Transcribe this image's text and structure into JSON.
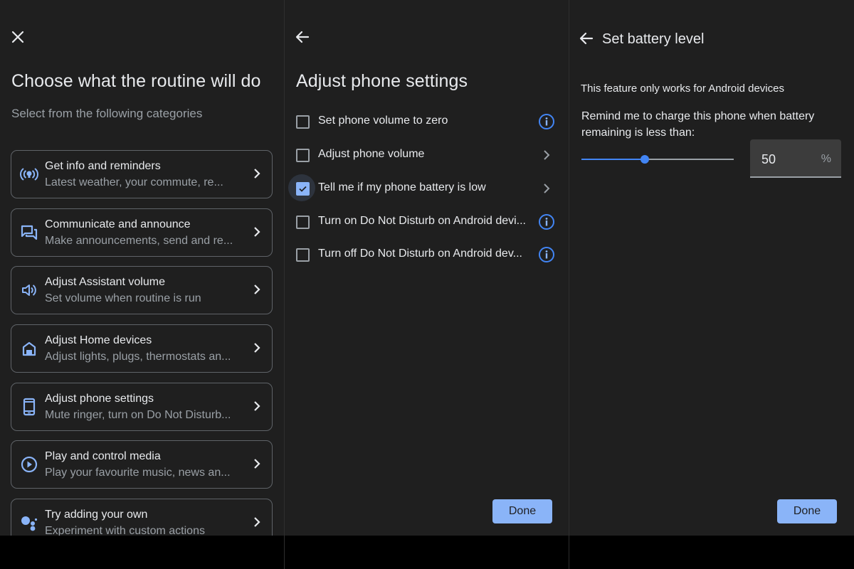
{
  "panel1": {
    "close_icon": "close-icon",
    "title": "Choose what the routine will do",
    "subtitle": "Select from the following categories",
    "categories": [
      {
        "icon": "broadcast-lightbulb-icon",
        "title": "Get info and reminders",
        "desc": "Latest weather, your commute, re..."
      },
      {
        "icon": "chat-bubbles-icon",
        "title": "Communicate and announce",
        "desc": "Make announcements, send and re..."
      },
      {
        "icon": "speaker-volume-icon",
        "title": "Adjust Assistant volume",
        "desc": "Set volume when routine is run"
      },
      {
        "icon": "home-icon",
        "title": "Adjust Home devices",
        "desc": "Adjust lights, plugs, thermostats an..."
      },
      {
        "icon": "phone-icon",
        "title": "Adjust phone settings",
        "desc": "Mute ringer, turn on Do Not Disturb..."
      },
      {
        "icon": "play-circle-icon",
        "title": "Play and control media",
        "desc": "Play your favourite music, news an..."
      },
      {
        "icon": "assistant-dots-icon",
        "title": "Try adding your own",
        "desc": "Experiment with custom actions"
      }
    ]
  },
  "panel2": {
    "back_icon": "back-arrow-icon",
    "title": "Adjust phone settings",
    "options": [
      {
        "label": "Set phone volume to zero",
        "checked": false,
        "tail": "info"
      },
      {
        "label": "Adjust phone volume",
        "checked": false,
        "tail": "chevron"
      },
      {
        "label": "Tell me if my phone battery is low",
        "checked": true,
        "tail": "chevron"
      },
      {
        "label": "Turn on Do Not Disturb on Android devi...",
        "checked": false,
        "tail": "info"
      },
      {
        "label": "Turn off Do Not Disturb on Android dev...",
        "checked": false,
        "tail": "info"
      }
    ],
    "done_label": "Done"
  },
  "panel3": {
    "back_icon": "back-arrow-icon",
    "title": "Set battery level",
    "note": "This feature only works for Android devices",
    "prompt": "Remind me to charge this phone when battery remaining is less than:",
    "slider_value_percent": 50,
    "value": "50",
    "unit": "%",
    "done_label": "Done"
  },
  "colors": {
    "background": "#1f1f1f",
    "accent": "#8ab4f8",
    "slider": "#4285f4",
    "text": "#e8eaed",
    "muted": "#9aa0a6"
  }
}
